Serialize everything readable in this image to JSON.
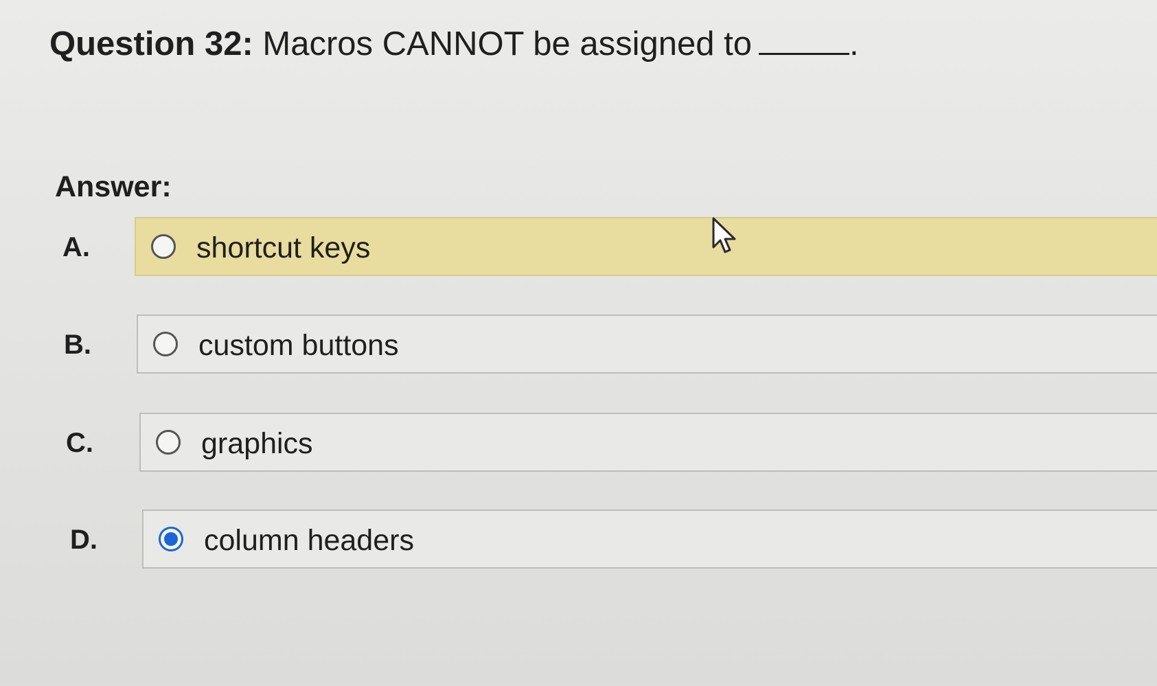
{
  "question": {
    "number_label": "Question 32:",
    "text": "Macros CANNOT be assigned to",
    "trailing": "."
  },
  "answer_label": "Answer:",
  "options": [
    {
      "letter": "A.",
      "text": "shortcut keys",
      "selected": false,
      "highlighted": true
    },
    {
      "letter": "B.",
      "text": "custom buttons",
      "selected": false,
      "highlighted": false
    },
    {
      "letter": "C.",
      "text": "graphics",
      "selected": false,
      "highlighted": false
    },
    {
      "letter": "D.",
      "text": "column headers",
      "selected": true,
      "highlighted": false
    }
  ],
  "colors": {
    "highlight": "#e8dc9e",
    "radio_selected": "#1a66d6"
  },
  "icons": {
    "cursor": "mouse-pointer-icon",
    "radio": "radio-button-icon"
  }
}
